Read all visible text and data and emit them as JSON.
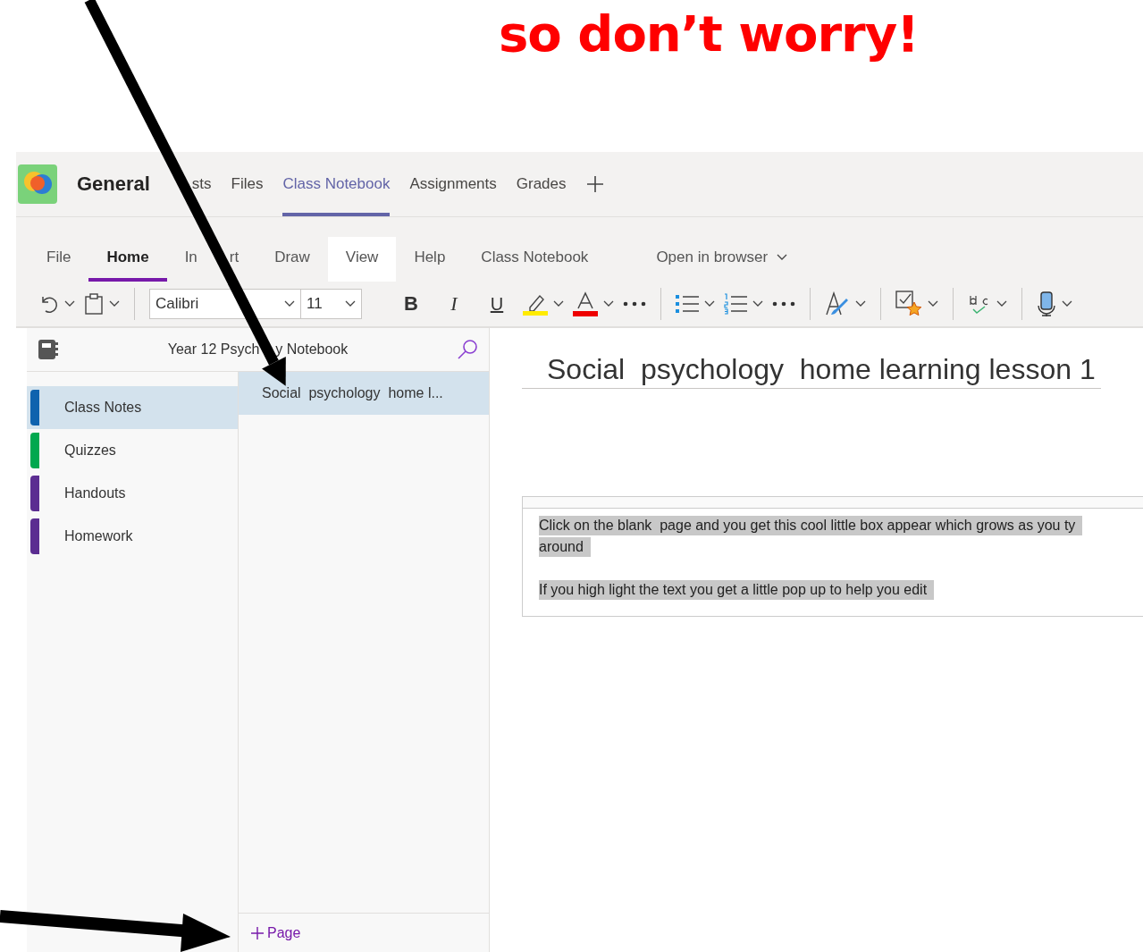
{
  "annotation": {
    "headline": "so don’t worry!"
  },
  "header": {
    "team": "General",
    "tabs": [
      {
        "label": "sts",
        "selected": false,
        "kind": "covered_start"
      },
      {
        "label": "Files",
        "selected": false
      },
      {
        "label": "Class Notebook",
        "selected": true
      },
      {
        "label": "Assignments",
        "selected": false
      },
      {
        "label": "Grades",
        "selected": false
      }
    ]
  },
  "ribbon": {
    "tabs": [
      {
        "label": "File",
        "selected": false,
        "hovered": false
      },
      {
        "label": "Home",
        "selected": true,
        "hovered": false
      },
      {
        "label": "In",
        "label_tail": "rt",
        "selected": false,
        "hovered": false
      },
      {
        "label": "Draw",
        "selected": false,
        "hovered": false
      },
      {
        "label": "View",
        "selected": false,
        "hovered": true
      },
      {
        "label": "Help",
        "selected": false,
        "hovered": false
      },
      {
        "label": "Class Notebook",
        "selected": false,
        "hovered": false
      },
      {
        "label": "Open in browser",
        "selected": false,
        "hovered": false,
        "kind": "menu"
      }
    ]
  },
  "toolbar": {
    "font": "Calibri",
    "size": "11",
    "format_buttons": [
      {
        "label": "B",
        "kind": "bold"
      },
      {
        "label": "I",
        "kind": "italic"
      },
      {
        "label": "U",
        "kind": "underline"
      }
    ]
  },
  "notebook": {
    "title": "Year 12 Psych",
    "title_tail": "y Notebook",
    "sections": [
      {
        "label": "Class Notes",
        "selected": true,
        "color": "#0f62ae"
      },
      {
        "label": "Quizzes",
        "selected": false,
        "color": "#00a84f"
      },
      {
        "label": "Handouts",
        "selected": false,
        "color": "#5b2d91"
      },
      {
        "label": "Homework",
        "selected": false,
        "color": "#5b2d91"
      }
    ],
    "pages": [
      {
        "label": "Social  psychology  home l...",
        "selected": true
      }
    ],
    "add_page": "Page"
  },
  "page": {
    "title": "Social  psychology  home learning lesson 1",
    "paragraphs": [
      [
        "Click on the blank  page and you get this cool little box appear which grows as you ty",
        "around"
      ],
      [
        "If you high light the text you get a little pop up to help you edit"
      ]
    ]
  }
}
